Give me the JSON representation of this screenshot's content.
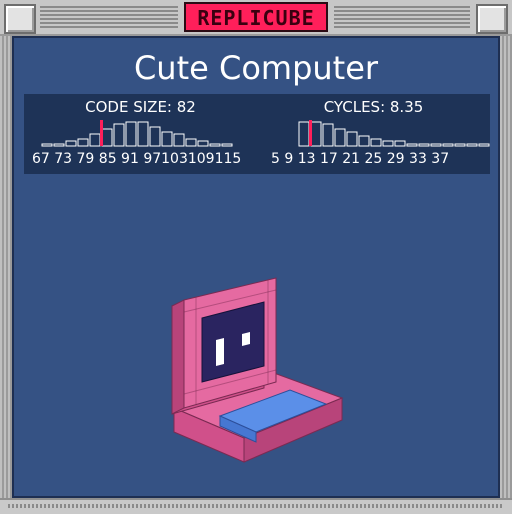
{
  "window": {
    "title": "REPLICUBE"
  },
  "puzzle": {
    "title": "Cute Computer"
  },
  "stats": {
    "code_size": {
      "label": "CODE SIZE: 82",
      "ticks": "67 73 79 85 91 97103109115",
      "current": 82,
      "bars": [
        1,
        1,
        2,
        3,
        5,
        7,
        9,
        10,
        10,
        8,
        6,
        5,
        3,
        2,
        1,
        1
      ],
      "highlight_index": 5,
      "marker_color": "#ff1f5a"
    },
    "cycles": {
      "label": "CYCLES: 8.35",
      "ticks": "5  9  13 17 21 25 29 33 37",
      "current": 8.35,
      "bars": [
        10,
        10,
        9,
        7,
        6,
        4,
        3,
        2,
        2,
        1,
        1,
        1,
        1,
        1,
        1,
        1
      ],
      "highlight_index": 1,
      "marker_color": "#ff1f5a"
    }
  },
  "colors": {
    "background": "#355284",
    "panel": "#1e3357",
    "cube_pink": "#e56aa1",
    "cube_screen": "#2a2460",
    "cube_keys": "#5b8fe8",
    "accent": "#ff1f5a"
  }
}
